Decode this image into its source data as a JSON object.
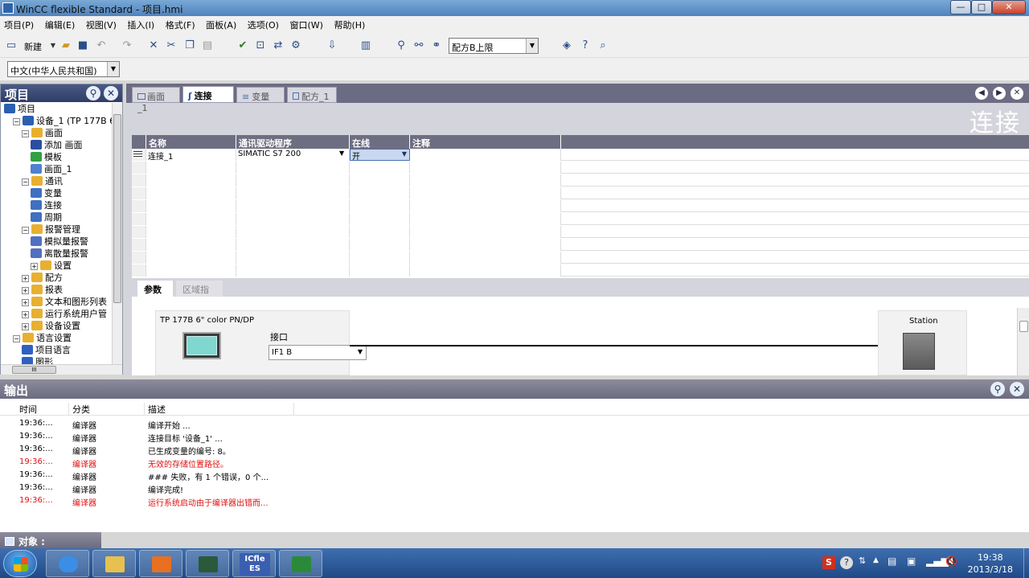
{
  "window": {
    "title": "WinCC flexible Standard - 项目.hmi",
    "min": "—",
    "max": "□",
    "close": "✕"
  },
  "menu": [
    "项目(P)",
    "编辑(E)",
    "视图(V)",
    "插入(I)",
    "格式(F)",
    "面板(A)",
    "选项(O)",
    "窗口(W)",
    "帮助(H)"
  ],
  "toolbar": {
    "new_label": "新建",
    "recipe_select": "配方B上限",
    "language_select": "中文(中华人民共和国)"
  },
  "project": {
    "title": "项目",
    "tree": [
      {
        "label": "项目",
        "indent": 0,
        "pm": "",
        "color": "#2a5fb0"
      },
      {
        "label": "设备_1 (TP 177B 6'",
        "indent": 1,
        "pm": "−",
        "color": "#2a5fb0"
      },
      {
        "label": "画面",
        "indent": 2,
        "pm": "−",
        "color": "#e8b030"
      },
      {
        "label": "添加 画面",
        "indent": 3,
        "pm": "",
        "color": "#2a4fa0"
      },
      {
        "label": "模板",
        "indent": 3,
        "pm": "",
        "color": "#30a040"
      },
      {
        "label": "画面_1",
        "indent": 3,
        "pm": "",
        "color": "#5080d0"
      },
      {
        "label": "通讯",
        "indent": 2,
        "pm": "−",
        "color": "#e8b030"
      },
      {
        "label": "变量",
        "indent": 3,
        "pm": "",
        "color": "#4070c0"
      },
      {
        "label": "连接",
        "indent": 3,
        "pm": "",
        "color": "#4070c0"
      },
      {
        "label": "周期",
        "indent": 3,
        "pm": "",
        "color": "#4070c0"
      },
      {
        "label": "报警管理",
        "indent": 2,
        "pm": "−",
        "color": "#e8b030"
      },
      {
        "label": "模拟量报警",
        "indent": 3,
        "pm": "",
        "color": "#5070c0"
      },
      {
        "label": "离散量报警",
        "indent": 3,
        "pm": "",
        "color": "#5070c0"
      },
      {
        "label": "设置",
        "indent": 3,
        "pm": "+",
        "color": "#e8b030"
      },
      {
        "label": "配方",
        "indent": 2,
        "pm": "+",
        "color": "#e8b030"
      },
      {
        "label": "报表",
        "indent": 2,
        "pm": "+",
        "color": "#e8b030"
      },
      {
        "label": "文本和图形列表",
        "indent": 2,
        "pm": "+",
        "color": "#e8b030"
      },
      {
        "label": "运行系统用户管",
        "indent": 2,
        "pm": "+",
        "color": "#e8b030"
      },
      {
        "label": "设备设置",
        "indent": 2,
        "pm": "+",
        "color": "#e8b030"
      },
      {
        "label": "语言设置",
        "indent": 1,
        "pm": "−",
        "color": "#e8b030"
      },
      {
        "label": "项目语言",
        "indent": 2,
        "pm": "",
        "color": "#3060c0"
      },
      {
        "label": "图形",
        "indent": 2,
        "pm": "",
        "color": "#3060c0"
      }
    ],
    "hscroll_label": "III"
  },
  "editor": {
    "tabs": [
      "画面_1",
      "连接",
      "变量",
      "配方_1"
    ],
    "active_tab": 1,
    "title": "连接",
    "columns": [
      "名称",
      "通讯驱动程序",
      "在线",
      "注释"
    ],
    "rows": [
      {
        "name": "连接_1",
        "driver": "SIMATIC S7 200",
        "online": "开",
        "comment": ""
      }
    ],
    "param_tabs": [
      "参数",
      "区域指针"
    ],
    "device": "TP 177B 6\" color PN/DP",
    "interface_label": "接口",
    "interface_value": "IF1 B",
    "station": "Station"
  },
  "output": {
    "title": "输出",
    "columns": [
      "时间",
      "分类",
      "描述"
    ],
    "rows": [
      {
        "time": "19:36:...",
        "category": "编译器",
        "desc": "编译开始 ...",
        "error": false
      },
      {
        "time": "19:36:...",
        "category": "编译器",
        "desc": "连接目标 '设备_1' ...",
        "error": false
      },
      {
        "time": "19:36:...",
        "category": "编译器",
        "desc": "已生成变量的编号: 8。",
        "error": false
      },
      {
        "time": "19:36:...",
        "category": "编译器",
        "desc": "无效的存储位置路径。",
        "error": true
      },
      {
        "time": "19:36:...",
        "category": "编译器",
        "desc": "### 失败，有 1 个错误，0 个...",
        "error": false
      },
      {
        "time": "19:36:...",
        "category": "编译器",
        "desc": "编译完成!",
        "error": false
      },
      {
        "time": "19:36:...",
        "category": "编译器",
        "desc": "运行系统启动由于编译器出错而...",
        "error": true
      }
    ]
  },
  "object_bar": {
    "label": "对象 :"
  },
  "taskbar": {
    "apps": [
      {
        "name": "ie-icon",
        "color": "#3a8ee6"
      },
      {
        "name": "explorer-icon",
        "color": "#e8c050"
      },
      {
        "name": "media-player-icon",
        "color": "#e87020"
      },
      {
        "name": "wincc-window-icon",
        "color": "#2a5a3a"
      },
      {
        "name": "wincc-es-icon",
        "color": "#3a5fb0"
      },
      {
        "name": "excel-icon",
        "color": "#2a8a3a"
      }
    ],
    "wincc_es_label": "ES",
    "wincc_es_top": "ICfle",
    "time": "19:38",
    "date": "2013/3/18"
  },
  "colors": {
    "error": "#e01010",
    "header_dark": "#6e6e82",
    "taskbar": "#2b5a9a"
  }
}
